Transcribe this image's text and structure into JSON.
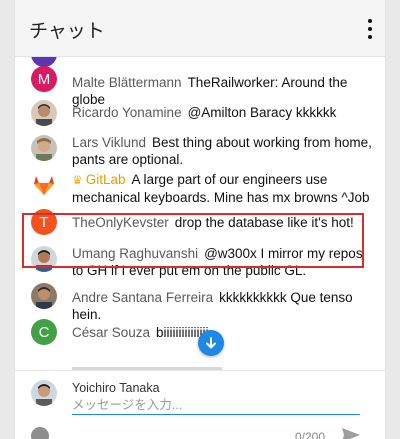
{
  "header": {
    "title": "チャット"
  },
  "messages": [
    {
      "sender": "Malte Blättermann",
      "text": "TheRailworker: Around the globe",
      "avatar_letter": "M",
      "avatar_color": "#d81b60"
    },
    {
      "sender": "Ricardo Yonamine",
      "text": "@Amilton Baracy kkkkkk",
      "avatar_letter": "",
      "avatar_color": ""
    },
    {
      "sender": "Lars Viklund",
      "text": "Best thing about working from home, pants are optional.",
      "avatar_letter": "",
      "avatar_color": ""
    },
    {
      "sender": "GitLab",
      "text": "A large part of our engineers use mechanical keyboards. Mine has mx browns ^Job",
      "avatar_letter": "",
      "avatar_color": ""
    },
    {
      "sender": "TheOnlyKevster",
      "text": "drop the database like it's hot!",
      "avatar_letter": "T",
      "avatar_color": "#f4511e"
    },
    {
      "sender": "Umang Raghuvanshi",
      "text": "@w300x I mirror my repos to GH if I ever put em on the public GL.",
      "avatar_letter": "",
      "avatar_color": ""
    },
    {
      "sender": "Andre Santana Ferreira",
      "text": "kkkkkkkkkk Que tenso hein.",
      "avatar_letter": "",
      "avatar_color": ""
    },
    {
      "sender": "César Souza",
      "text": "biiiiiiiiiiiiiii",
      "avatar_letter": "C",
      "avatar_color": "#43a047"
    }
  ],
  "composer": {
    "user_name": "Yoichiro Tanaka",
    "placeholder": "メッセージを入力...",
    "counter": "0/200"
  },
  "icons": {
    "kebab": "more-vert-icon",
    "crown": "crown-icon",
    "scroll": "arrow-down-icon",
    "emoji": "emoji-icon",
    "send": "send-icon"
  },
  "colors": {
    "highlight": "#d32f2f",
    "accent": "#1e88e5",
    "gitlab": "#e5a000"
  }
}
